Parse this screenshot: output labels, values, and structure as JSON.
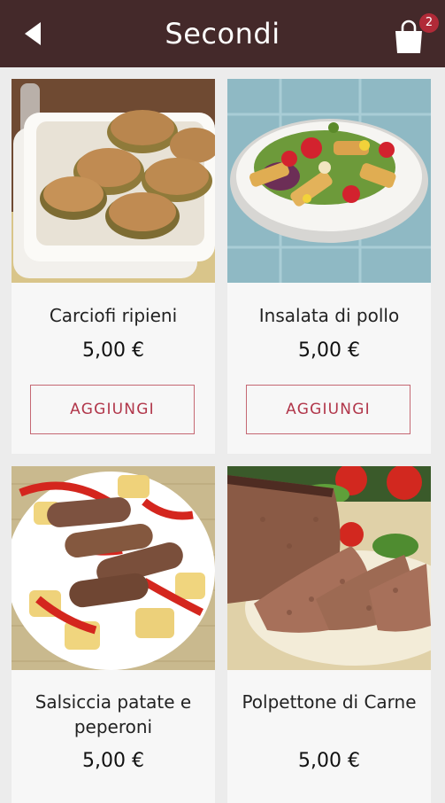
{
  "header": {
    "title": "Secondi",
    "cart_count": "2"
  },
  "products": [
    {
      "name": "Carciofi ripieni",
      "price": "5,00 €",
      "button_label": "AGGIUNGI"
    },
    {
      "name": "Insalata di pollo",
      "price": "5,00 €",
      "button_label": "AGGIUNGI"
    },
    {
      "name": "Salsiccia patate e peperoni",
      "price": "5,00 €"
    },
    {
      "name": "Polpettone di Carne",
      "price": "5,00 €"
    }
  ],
  "colors": {
    "header_bg": "#44292a",
    "badge": "#b12a38",
    "button_accent": "#b1364a"
  },
  "icons": [
    "back-arrow-icon",
    "shopping-bag-icon"
  ]
}
